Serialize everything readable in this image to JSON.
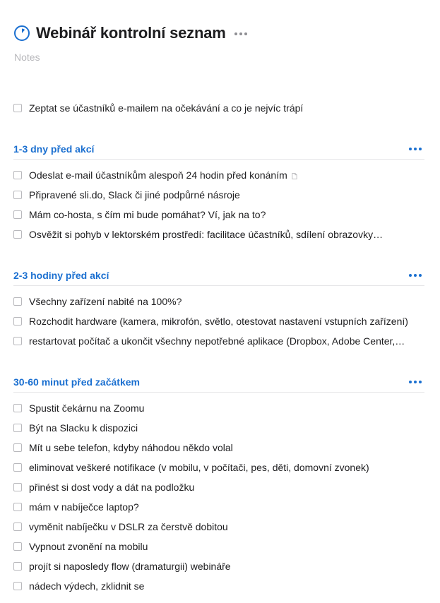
{
  "project": {
    "title": "Webinář kontrolní seznam",
    "notes_placeholder": "Notes",
    "icon": "progress-circle-icon",
    "more_icon": "ellipsis-icon"
  },
  "top_todos": [
    {
      "label": "Zeptat se účastníků e-mailem na očekávání a co je nejvíc trápí"
    }
  ],
  "sections": [
    {
      "heading": "1-3 dny před akcí",
      "todos": [
        {
          "label": "Odeslat e-mail účastníkům alespoň 24 hodin před konáním",
          "has_note": true
        },
        {
          "label": "Připravené sli.do, Slack či jiné podpůrné násroje"
        },
        {
          "label": "Mám co-hosta, s čím mi bude pomáhat? Ví, jak na to?"
        },
        {
          "label": "Osvěžit si pohyb v lektorském prostředí: facilitace účastníků, sdílení obrazovky…"
        }
      ]
    },
    {
      "heading": "2-3 hodiny před akcí",
      "todos": [
        {
          "label": "Všechny zařízení nabité na 100%?"
        },
        {
          "label": "Rozchodit hardware (kamera, mikrofón, světlo, otestovat nastavení vstupních zařízení)"
        },
        {
          "label": "restartovat počítač a ukončit všechny nepotřebné aplikace (Dropbox, Adobe Center,…"
        }
      ]
    },
    {
      "heading": "30-60 minut před začátkem",
      "todos": [
        {
          "label": "Spustit čekárnu na Zoomu"
        },
        {
          "label": "Být na Slacku k dispozici"
        },
        {
          "label": "Mít u sebe telefon, kdyby náhodou někdo volal"
        },
        {
          "label": "eliminovat veškeré notifikace (v mobilu, v počítači, pes, děti, domovní zvonek)"
        },
        {
          "label": "přinést si dost vody a dát na podložku"
        },
        {
          "label": "mám v nabíječce laptop?"
        },
        {
          "label": "vyměnit nabíječku v DSLR za čerstvě dobitou"
        },
        {
          "label": "Vypnout zvonění na mobilu"
        },
        {
          "label": "projít si naposledy flow (dramaturgii) webináře"
        },
        {
          "label": "nádech výdech, zklidnit se"
        }
      ]
    }
  ],
  "colors": {
    "accent": "#1a6fd0",
    "text": "#1d1d1f",
    "muted": "#b7b7bb"
  }
}
